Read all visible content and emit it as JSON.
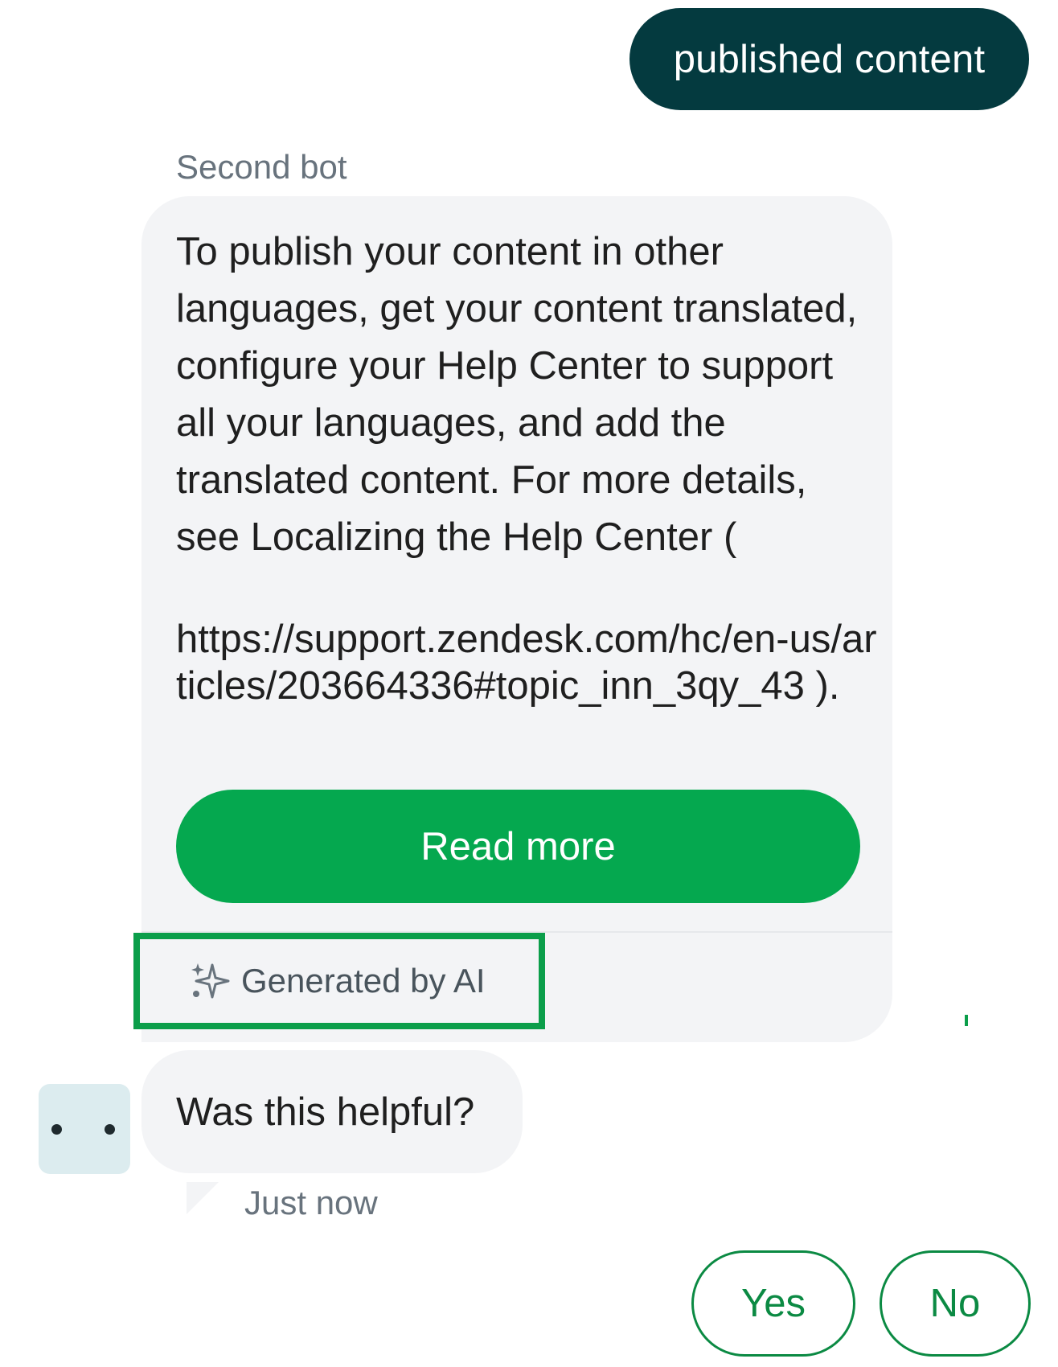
{
  "user_message": {
    "text": "published content",
    "color": "#043a3f"
  },
  "bot": {
    "name": "Second bot",
    "message": "To publish your content in other languages, get your content translated, configure your Help Center to support all your languages, and add the translated content. For more details, see Localizing the Help Center (",
    "url_text": "https://support.zendesk.com/hc/en-us/articles/203664336#topic_inn_3qy_43 ).",
    "read_more_label": "Read more",
    "accent_color": "#05a84f",
    "ai_label": "Generated by AI",
    "ai_icon": "sparkle-icon"
  },
  "followup": {
    "question": "Was this helpful?",
    "timestamp": "Just now",
    "options": [
      {
        "label": "Yes"
      },
      {
        "label": "No"
      }
    ]
  },
  "avatar": {
    "icon": "bot-avatar-icon"
  }
}
